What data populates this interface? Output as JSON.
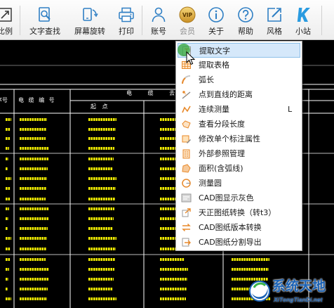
{
  "toolbar": {
    "buttons": [
      {
        "label": "比例",
        "icon": "scale-icon"
      },
      {
        "label": "文字查找",
        "icon": "text-search-icon"
      },
      {
        "label": "屏幕旋转",
        "icon": "screen-rotate-icon"
      },
      {
        "label": "打印",
        "icon": "printer-icon"
      },
      {
        "label": "账号",
        "icon": "account-icon"
      },
      {
        "label": "会员",
        "icon": "vip-icon",
        "badge_text": "VIP"
      },
      {
        "label": "关于",
        "icon": "info-icon"
      },
      {
        "label": "帮助",
        "icon": "help-icon"
      },
      {
        "label": "风格",
        "icon": "style-icon"
      },
      {
        "label": "小站",
        "icon": "k-site-icon"
      }
    ]
  },
  "drawing": {
    "header": {
      "index": "序号",
      "cable_no": "电 缆 编 号",
      "route": "电 缆 去",
      "start": "起 点"
    }
  },
  "menu": {
    "items": [
      {
        "label": "提取文字",
        "icon": "extract-text-icon",
        "highlighted": true
      },
      {
        "label": "提取表格",
        "icon": "extract-table-icon"
      },
      {
        "label": "弧长",
        "icon": "arc-length-icon"
      },
      {
        "label": "点到直线的距离",
        "icon": "point-line-distance-icon"
      },
      {
        "label": "连续测量",
        "icon": "continuous-measure-icon",
        "shortcut": "L"
      },
      {
        "label": "查看分段长度",
        "icon": "segment-length-icon"
      },
      {
        "label": "修改单个标注属性",
        "icon": "edit-dimension-icon"
      },
      {
        "label": "外部参照管理",
        "icon": "xref-icon"
      },
      {
        "label": "面积(含弧线)",
        "icon": "area-icon"
      },
      {
        "label": "测量圆",
        "icon": "measure-circle-icon"
      },
      {
        "label": "CAD图显示灰色",
        "icon": "gray-display-icon"
      },
      {
        "label": "天正图纸转换（转t3）",
        "icon": "tangent-convert-icon"
      },
      {
        "label": "CAD图纸版本转换",
        "icon": "version-convert-icon"
      },
      {
        "label": "CAD图纸分割导出",
        "icon": "split-export-icon"
      }
    ]
  },
  "watermark": {
    "name": "系统天地",
    "domain": "XiTongTianDi.net"
  },
  "colors": {
    "toolbar_icon": "#2f7fc4",
    "drawing_bg": "#000000",
    "cad_text_yellow": "#f2ee00",
    "cad_line": "#ffffff",
    "menu_highlight": "#d5e8fa",
    "menu_icon_accent": "#e8892a",
    "watermark_blue": "#1b62b5"
  }
}
